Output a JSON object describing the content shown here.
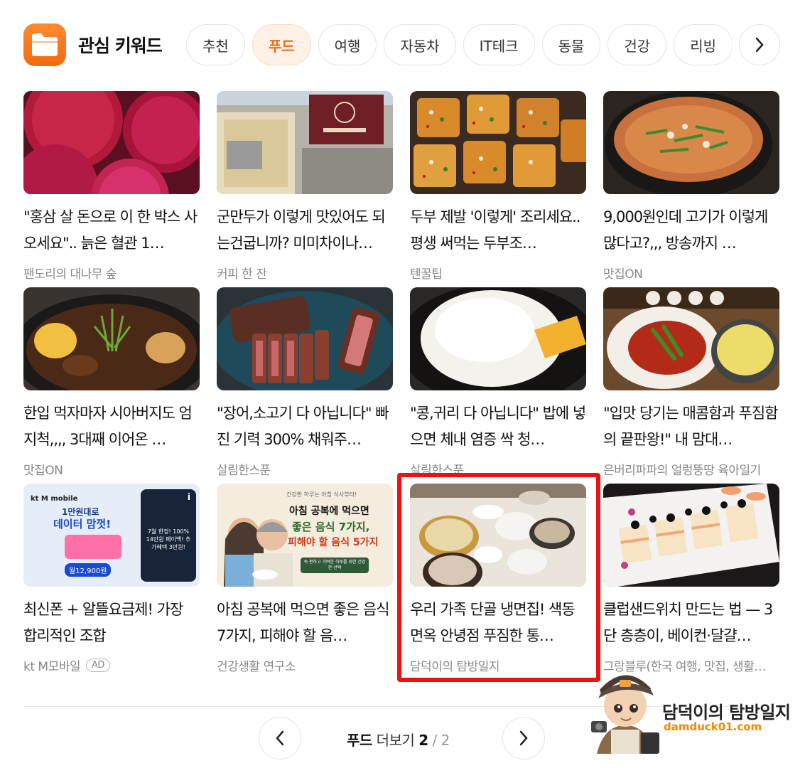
{
  "header": {
    "title": "관심 키워드",
    "icon": "folder-icon",
    "accent": "#f26a10",
    "chips": [
      {
        "label": "추천",
        "active": false
      },
      {
        "label": "푸드",
        "active": true
      },
      {
        "label": "여행",
        "active": false
      },
      {
        "label": "자동차",
        "active": false
      },
      {
        "label": "IT테크",
        "active": false
      },
      {
        "label": "동물",
        "active": false
      },
      {
        "label": "건강",
        "active": false
      },
      {
        "label": "리빙",
        "active": false
      }
    ]
  },
  "cards": [
    {
      "title": "\"홍삼 살 돈으로 이 한 박스 사 오세요\".. 늙은 혈관 1…",
      "source": "팬도리의 대나무 숲"
    },
    {
      "title": "군만두가 이렇게 맛있어도 되는건굽니까? 미미차이나…",
      "source": "커피 한 잔"
    },
    {
      "title": "두부 제발 '이렇게' 조리세요.. 평생 써먹는 두부조…",
      "source": "텐꿀팁"
    },
    {
      "title": "9,000원인데 고기가 이렇게 많다고?,,, 방송까지 …",
      "source": "맛집ON"
    },
    {
      "title": "한입 먹자마자 시아버지도 엄지척,,,, 3대째 이어온 …",
      "source": "맛집ON"
    },
    {
      "title": "\"장어,소고기 다 아닙니다\" 빠진 기력 300% 채워주…",
      "source": "살림한스푼"
    },
    {
      "title": "\"콩,귀리 다 아닙니다\" 밥에 넣으면 체내 염증 싹 청…",
      "source": "살림한스푼"
    },
    {
      "title": "\"입맛 당기는 매콤함과 푸짐함의 끝판왕!\" 내 맘대…",
      "source": "은버리파파의 얼렁뚱땅 육아일기"
    },
    {
      "title": "최신폰 + 알뜰요금제! 가장 합리적인 조합",
      "source": "kt M모바일",
      "ad": "AD",
      "ad_banner": {
        "brand": "kt M mobile",
        "line1": "1만원대로",
        "line2": "데이터 맘껏!",
        "price": "월12,900원",
        "side": "7월 한정! 100% 14만원 페이백! 추가혜택 3만원!"
      }
    },
    {
      "title": "아침 공복에 먹으면 좋은 음식 7가지, 피해야 할 음…",
      "source": "건강생활 연구소",
      "poster": {
        "top": "건강한 하루는 아침 식사부터!",
        "line1": "아침 공복에 먹으면",
        "line2": "좋은 음식 7가지,",
        "line3": "피해야 할 음식 5가지",
        "foot": "속 편하고 가벼운 하루를 위한 건강한 선택"
      }
    },
    {
      "title": "우리 가족 단골 냉면집! 색동면옥 안녕점 푸짐한 통…",
      "source": "담덕이의 탐방일지"
    },
    {
      "title": "클럽샌드위치 만드는 법 — 3단 층층이, 베이컨·달걀…",
      "source": "그랑블루(한국 여행, 맛집, 생활…"
    }
  ],
  "pager": {
    "label": "푸드",
    "more": "더보기",
    "current": "2",
    "sep": "/",
    "total": "2"
  },
  "watermark": {
    "title": "담덕이의 탐방일지",
    "url": "damduck01.com"
  }
}
